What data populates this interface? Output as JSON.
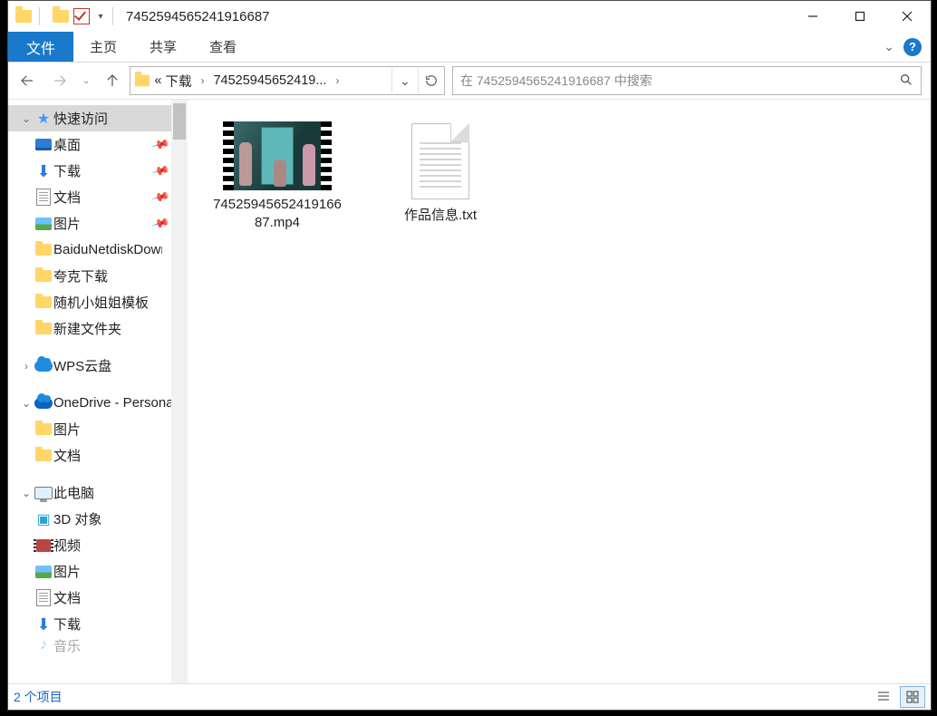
{
  "title": "7452594565241916687",
  "ribbon": {
    "file": "文件",
    "home": "主页",
    "share": "共享",
    "view": "查看"
  },
  "breadcrumbs": {
    "ellipsis": "«",
    "parent": "下载",
    "current": "74525945652419..."
  },
  "search_placeholder": "在 7452594565241916687 中搜索",
  "sidebar": {
    "quick_access": "快速访问",
    "desktop": "桌面",
    "downloads": "下载",
    "documents": "文档",
    "pictures": "图片",
    "baidu": "BaiduNetdiskDownload",
    "quark": "夸克下载",
    "random_template": "随机小姐姐模板",
    "new_folder": "新建文件夹",
    "wps": "WPS云盘",
    "onedrive": "OneDrive - Personal",
    "od_pictures": "图片",
    "od_documents": "文档",
    "this_pc": "此电脑",
    "pc_3d": "3D 对象",
    "pc_videos": "视频",
    "pc_pictures": "图片",
    "pc_documents": "文档",
    "pc_downloads": "下载",
    "pc_music_partial": "音乐"
  },
  "items": [
    {
      "name": "7452594565241916687.mp4",
      "type": "video"
    },
    {
      "name": "作品信息.txt",
      "type": "text"
    }
  ],
  "status_text": "2 个项目"
}
